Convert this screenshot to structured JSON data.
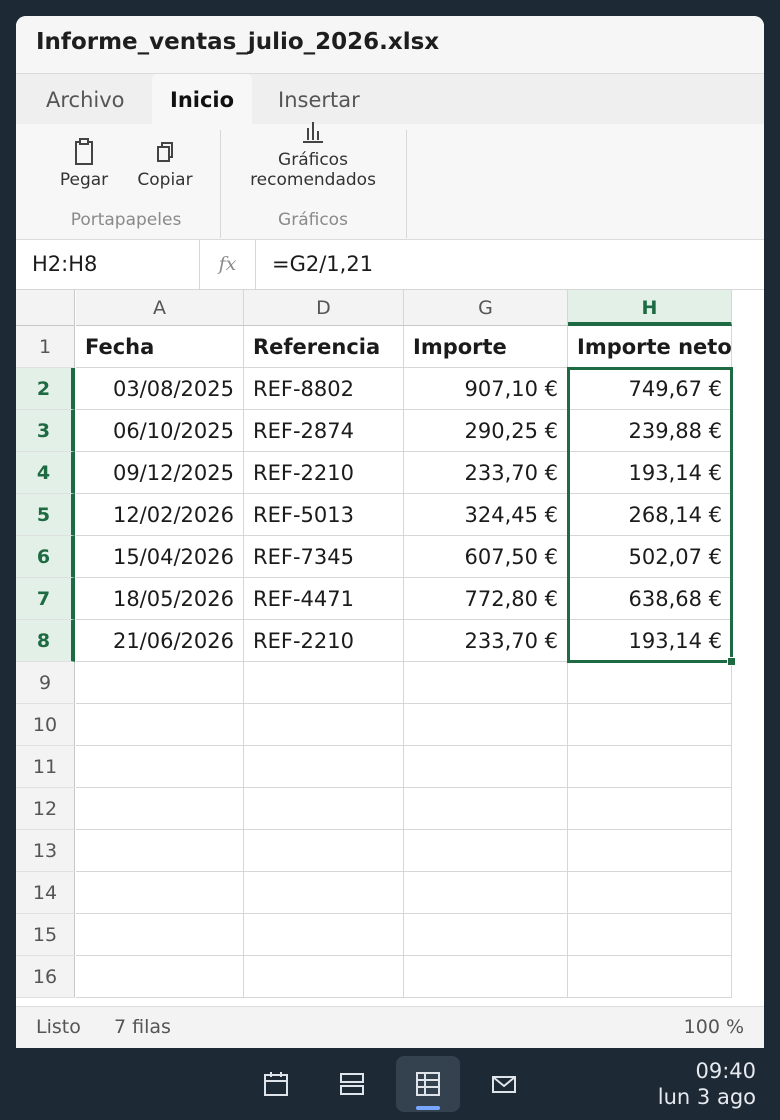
{
  "window": {
    "title": "Informe_ventas_julio_2026.xlsx"
  },
  "tabs": [
    {
      "label": "Archivo",
      "active": false
    },
    {
      "label": "Inicio",
      "active": true
    },
    {
      "label": "Insertar",
      "active": false
    }
  ],
  "ribbon": {
    "groups": [
      {
        "label": "Portapapeles",
        "buttons": [
          {
            "label": "Pegar",
            "icon": "paste-icon"
          },
          {
            "label": "Copiar",
            "icon": "copy-icon"
          }
        ]
      },
      {
        "label": "Gráficos",
        "buttons": [
          {
            "label_line1": "Gráficos",
            "label_line2": "recomendados",
            "icon": "chart-icon"
          }
        ]
      }
    ]
  },
  "formula_bar": {
    "name_box": "H2:H8",
    "fx_label": "fx",
    "formula": "=G2/1,21"
  },
  "sheet": {
    "columns": [
      {
        "letter": "A",
        "selected": false
      },
      {
        "letter": "D",
        "selected": false
      },
      {
        "letter": "G",
        "selected": false
      },
      {
        "letter": "H",
        "selected": true
      }
    ],
    "header_row": [
      "Fecha",
      "Referencia",
      "Importe",
      "Importe neto"
    ],
    "rows": [
      {
        "num": "2",
        "fecha": "03/08/2025",
        "ref": "REF-8802",
        "importe": "907,10 €",
        "neto": "749,67 €"
      },
      {
        "num": "3",
        "fecha": "06/10/2025",
        "ref": "REF-2874",
        "importe": "290,25 €",
        "neto": "239,88 €"
      },
      {
        "num": "4",
        "fecha": "09/12/2025",
        "ref": "REF-2210",
        "importe": "233,70 €",
        "neto": "193,14 €"
      },
      {
        "num": "5",
        "fecha": "12/02/2026",
        "ref": "REF-5013",
        "importe": "324,45 €",
        "neto": "268,14 €"
      },
      {
        "num": "6",
        "fecha": "15/04/2026",
        "ref": "REF-7345",
        "importe": "607,50 €",
        "neto": "502,07 €"
      },
      {
        "num": "7",
        "fecha": "18/05/2026",
        "ref": "REF-4471",
        "importe": "772,80 €",
        "neto": "638,68 €"
      },
      {
        "num": "8",
        "fecha": "21/06/2026",
        "ref": "REF-2210",
        "importe": "233,70 €",
        "neto": "193,14 €"
      }
    ],
    "row_numbers": [
      "1",
      "2",
      "3",
      "4",
      "5",
      "6",
      "7",
      "8",
      "9",
      "10",
      "11",
      "12",
      "13",
      "14",
      "15",
      "16"
    ],
    "selected_rows": [
      "2",
      "3",
      "4",
      "5",
      "6",
      "7",
      "8"
    ]
  },
  "status": {
    "ready": "Listo",
    "rows": "7 filas",
    "zoom": "100 %"
  },
  "taskbar": {
    "apps": [
      {
        "icon": "calendar-icon",
        "active": false
      },
      {
        "icon": "layout-icon",
        "active": false
      },
      {
        "icon": "spreadsheet-icon",
        "active": true
      },
      {
        "icon": "mail-icon",
        "active": false
      }
    ],
    "clock_time": "09:40",
    "clock_date": "lun 3 ago"
  },
  "colors": {
    "accent": "#1e6b43",
    "taskbar": "#1d2935",
    "taskbar_indicator": "#79a6ff"
  }
}
